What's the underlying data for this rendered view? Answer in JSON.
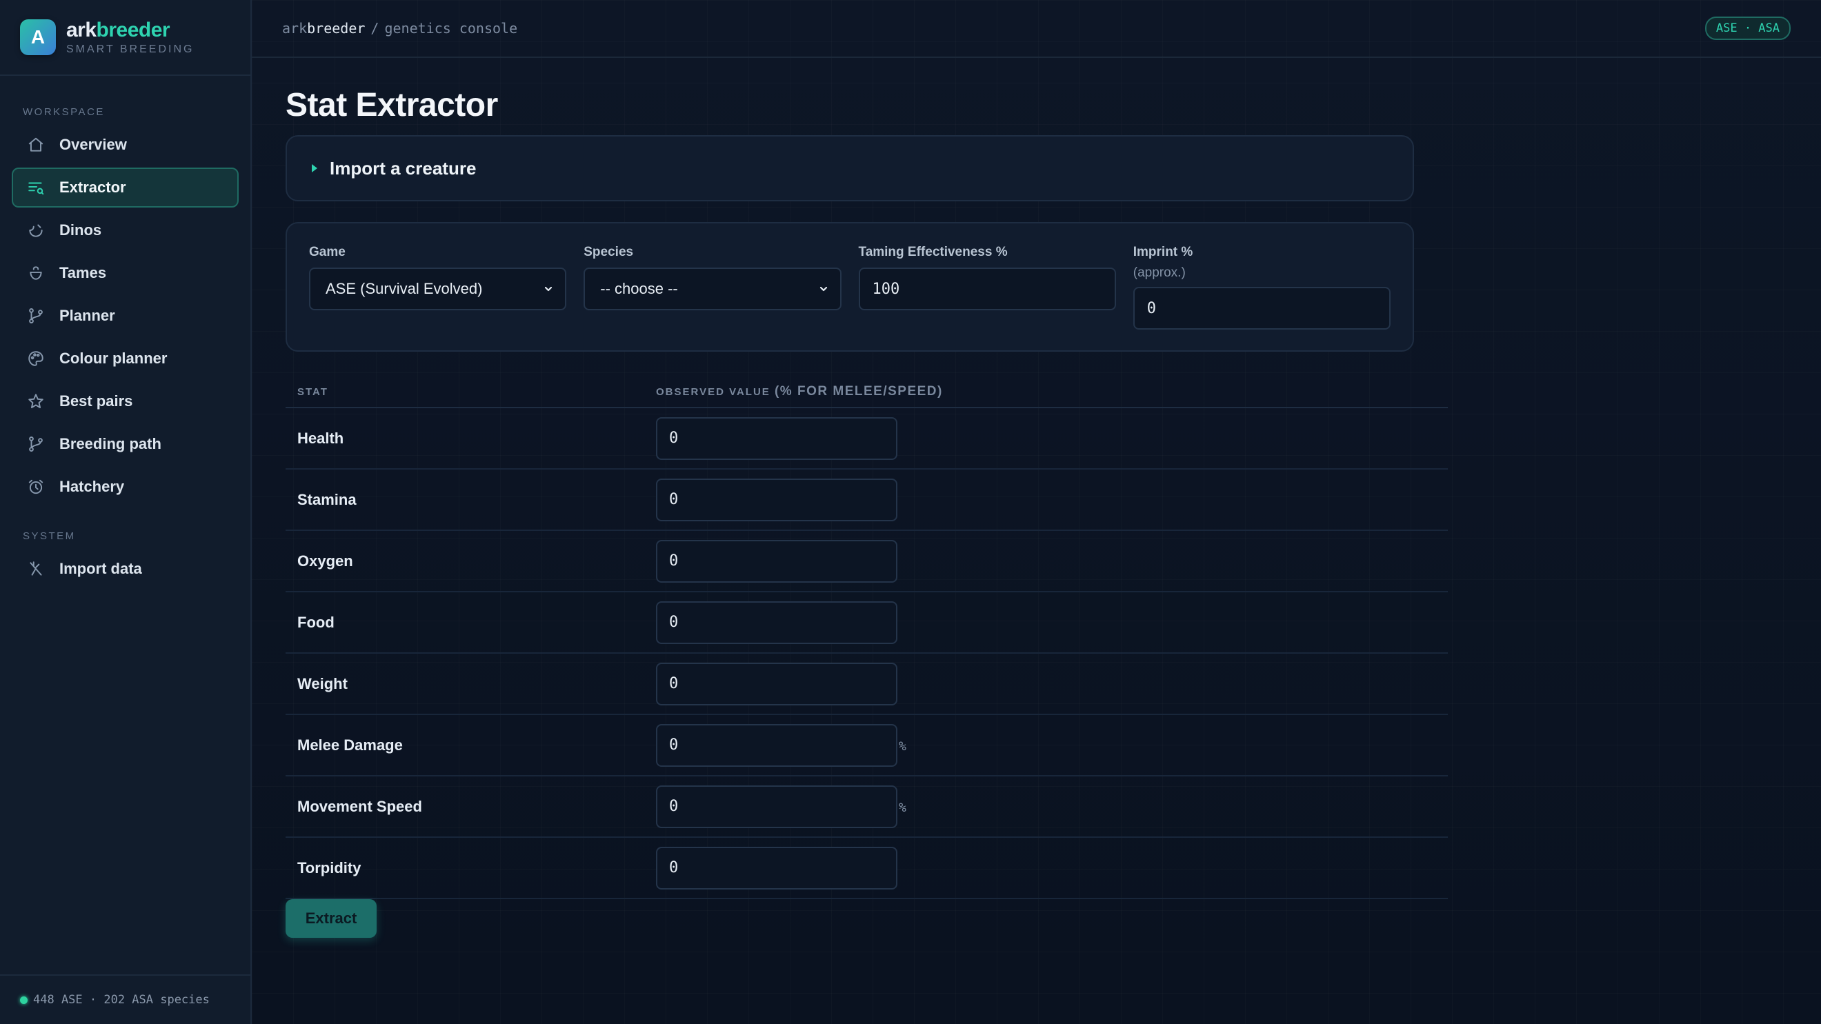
{
  "brand": {
    "initial": "A",
    "name_part1": "ark",
    "name_part2": "breeder",
    "tagline": "SMART BREEDING"
  },
  "sidebar": {
    "workspace_label": "WORKSPACE",
    "system_label": "SYSTEM",
    "items": [
      {
        "label": "Overview",
        "icon": "home-icon"
      },
      {
        "label": "Extractor",
        "icon": "extractor-icon",
        "active": true
      },
      {
        "label": "Dinos",
        "icon": "dino-icon"
      },
      {
        "label": "Tames",
        "icon": "tames-icon"
      },
      {
        "label": "Planner",
        "icon": "branch-icon"
      },
      {
        "label": "Colour planner",
        "icon": "palette-icon"
      },
      {
        "label": "Best pairs",
        "icon": "star-icon"
      },
      {
        "label": "Breeding path",
        "icon": "branch-icon"
      },
      {
        "label": "Hatchery",
        "icon": "clock-icon"
      }
    ],
    "system_items": [
      {
        "label": "Import data",
        "icon": "import-icon"
      }
    ],
    "footer": "448 ASE · 202 ASA species",
    "status_color": "#2ed3a0"
  },
  "topbar": {
    "crumb_ark": "ark",
    "crumb_breeder": "breeder",
    "crumb_sep": "/",
    "crumb_page": "genetics console",
    "badge": "ASE · ASA"
  },
  "page": {
    "title": "Stat Extractor",
    "import_label": "Import a creature"
  },
  "form": {
    "game": {
      "label": "Game",
      "value": "ASE (Survival Evolved)"
    },
    "species": {
      "label": "Species",
      "value": "-- choose --"
    },
    "taming": {
      "label": "Taming Effectiveness %",
      "value": "100"
    },
    "imprint": {
      "label": "Imprint %",
      "sub": "(approx.)",
      "value": "0"
    }
  },
  "table": {
    "col_stat": "STAT",
    "col_value": "OBSERVED VALUE",
    "col_value_note": "(% FOR MELEE/SPEED)",
    "rows": [
      {
        "name": "Health",
        "value": "0",
        "unit": ""
      },
      {
        "name": "Stamina",
        "value": "0",
        "unit": ""
      },
      {
        "name": "Oxygen",
        "value": "0",
        "unit": ""
      },
      {
        "name": "Food",
        "value": "0",
        "unit": ""
      },
      {
        "name": "Weight",
        "value": "0",
        "unit": ""
      },
      {
        "name": "Melee Damage",
        "value": "0",
        "unit": "%"
      },
      {
        "name": "Movement Speed",
        "value": "0",
        "unit": "%"
      },
      {
        "name": "Torpidity",
        "value": "0",
        "unit": ""
      }
    ]
  },
  "actions": {
    "extract_label": "Extract"
  },
  "colors": {
    "accent": "#2ed3b0",
    "bg": "#0b1322",
    "sidebar": "#111c2c"
  }
}
